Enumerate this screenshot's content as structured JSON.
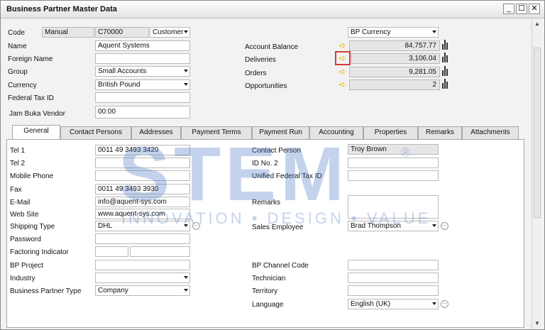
{
  "window": {
    "title": "Business Partner Master Data",
    "btn_min": "_",
    "btn_max": "☐",
    "btn_close": "✕"
  },
  "header": {
    "code_label": "Code",
    "code_series": "Manual",
    "code_value": "C70000",
    "code_type": "Customer",
    "name_label": "Name",
    "name_value": "Aquent Systems",
    "foreign_name_label": "Foreign Name",
    "foreign_name_value": "",
    "group_label": "Group",
    "group_value": "Small Accounts",
    "currency_label": "Currency",
    "currency_value": "British Pound",
    "federal_tax_label": "Federal Tax ID",
    "federal_tax_value": "",
    "jam_label": "Jam Buka Vendor",
    "jam_value": "00:00",
    "bp_currency": "BP Currency",
    "account_balance_label": "Account Balance",
    "account_balance_value": "84,757.77",
    "deliveries_label": "Deliveries",
    "deliveries_value": "3,106.04",
    "orders_label": "Orders",
    "orders_value": "9,281.05",
    "opportunities_label": "Opportunities",
    "opportunities_value": "2"
  },
  "tabs": [
    {
      "label": "General"
    },
    {
      "label": "Contact Persons"
    },
    {
      "label": "Addresses"
    },
    {
      "label": "Payment Terms"
    },
    {
      "label": "Payment Run"
    },
    {
      "label": "Accounting"
    },
    {
      "label": "Properties"
    },
    {
      "label": "Remarks"
    },
    {
      "label": "Attachments"
    }
  ],
  "general": {
    "tel1_label": "Tel 1",
    "tel1_value": "0011 49 3493 3420",
    "tel2_label": "Tel 2",
    "tel2_value": "",
    "mobile_label": "Mobile Phone",
    "mobile_value": "",
    "fax_label": "Fax",
    "fax_value": "0011 49 3493 3930",
    "email_label": "E-Mail",
    "email_value": "info@aquent-sys.com",
    "website_label": "Web Site",
    "website_value": "www.aquent-sys.com",
    "shipping_label": "Shipping Type",
    "shipping_value": "DHL",
    "password_label": "Password",
    "password_value": "",
    "factoring_label": "Factoring Indicator",
    "bp_project_label": "BP Project",
    "bp_project_value": "",
    "industry_label": "Industry",
    "industry_value": "",
    "bp_type_label": "Business Partner Type",
    "bp_type_value": "Company",
    "contact_label": "Contact Person",
    "contact_value": "Troy Brown",
    "id2_label": "ID No. 2",
    "id2_value": "",
    "unified_label": "Unified Federal Tax ID",
    "unified_value": "",
    "remarks_label": "Remarks",
    "remarks_value": "",
    "sales_label": "Sales Employee",
    "sales_value": "Brad Thompson",
    "channel_label": "BP Channel Code",
    "channel_value": "",
    "technician_label": "Technician",
    "technician_value": "",
    "territory_label": "Territory",
    "territory_value": "",
    "language_label": "Language",
    "language_value": "English (UK)"
  },
  "watermark": {
    "brand": "STEM",
    "reg": "®",
    "tagline": "INNOVATION • DESIGN • VALUE"
  },
  "colors": {
    "highlight": "#d63a3a",
    "arrow": "#e6b800"
  }
}
